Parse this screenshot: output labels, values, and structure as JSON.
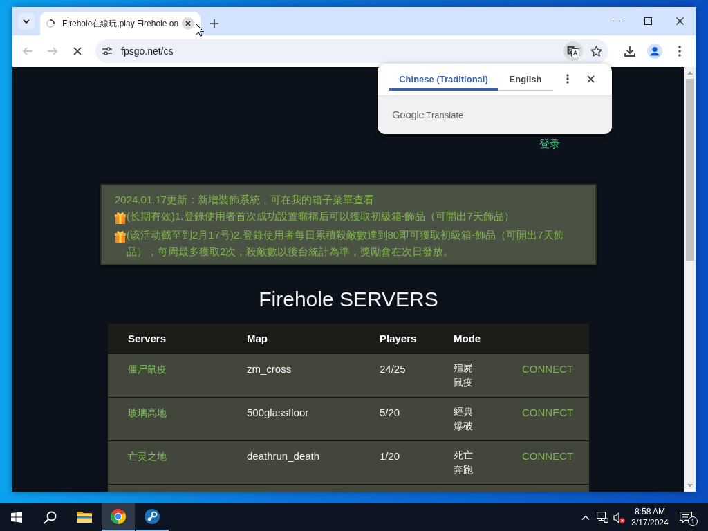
{
  "browser": {
    "tabs": [
      {
        "title": "Firehole在線玩,play Firehole on",
        "selected": true
      }
    ],
    "toolbar": {
      "back_enabled": false,
      "forward_enabled": false,
      "loading": true,
      "url": "fpsgo.net/cs"
    }
  },
  "translate_popup": {
    "tabs": [
      {
        "label": "Chinese (Traditional)",
        "selected": true
      },
      {
        "label": "English",
        "selected": false
      }
    ],
    "brand": "Google",
    "product": "Translate"
  },
  "page": {
    "login_link": "登录",
    "notice": [
      {
        "kind": "plain",
        "text": "2024.01.17更新：新增裝飾系統，可在我的箱子菜單查看"
      },
      {
        "kind": "gift",
        "text": "(长期有效)1.登錄使用者首次成功設置暱稱后可以獲取初級箱-飾品（可開出7天飾品）"
      },
      {
        "kind": "gift",
        "text": "(该活动截至到2月17号)2.登錄使用者每日累積殺敵數達到80即可獲取初級箱-飾品（可開出7天飾品），每周最多獲取2次，殺敵數以後台統計為準，獎勵會在次日發放。"
      }
    ],
    "title": "Firehole SERVERS",
    "table": {
      "columns": [
        "Servers",
        "Map",
        "Players",
        "Mode"
      ],
      "rows": [
        {
          "server": "僵尸鼠疫",
          "map": "zm_cross",
          "players": "24/25",
          "mode": "殭屍鼠疫",
          "action": "CONNECT"
        },
        {
          "server": "玻璃高地",
          "map": "500glassfloor",
          "players": "5/20",
          "mode": "經典爆破",
          "action": "CONNECT"
        },
        {
          "server": "亡灵之地",
          "map": "deathrun_death",
          "players": "1/20",
          "mode": "死亡奔跑",
          "action": "CONNECT"
        }
      ]
    }
  },
  "taskbar": {
    "apps": [
      {
        "kind": "explorer",
        "running": false,
        "active": false
      },
      {
        "kind": "chrome",
        "running": true,
        "active": true
      },
      {
        "kind": "steam",
        "running": true,
        "active": false
      }
    ],
    "volume_muted": true,
    "clock": {
      "time": "8:58 AM",
      "date": "3/17/2024"
    },
    "notifications": "1"
  }
}
